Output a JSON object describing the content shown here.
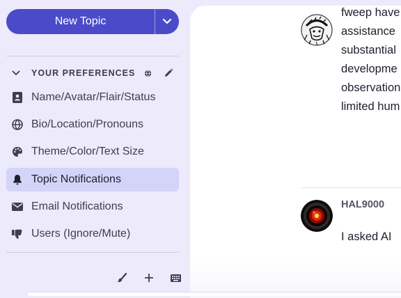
{
  "sidebar": {
    "new_topic_label": "New Topic",
    "section_title": "YOUR PREFERENCES",
    "items": [
      {
        "label": "Name/Avatar/Flair/Status",
        "icon": "id-card-icon"
      },
      {
        "label": "Bio/Location/Pronouns",
        "icon": "globe-icon"
      },
      {
        "label": "Theme/Color/Text Size",
        "icon": "palette-icon"
      },
      {
        "label": "Topic Notifications",
        "icon": "bell-icon",
        "active": true
      },
      {
        "label": "Email Notifications",
        "icon": "envelope-icon"
      },
      {
        "label": "Users (Ignore/Mute)",
        "icon": "thumbs-down-icon"
      }
    ]
  },
  "posts": [
    {
      "avatar": "luffy-sketch-avatar",
      "lines": [
        "fweep have",
        "assistance",
        "substantial",
        "developme",
        "observation",
        "limited hum"
      ]
    },
    {
      "username": "HAL9000",
      "avatar": "hal9000-red-eye-avatar",
      "lines": [
        "I asked AI"
      ]
    }
  ],
  "colors": {
    "accent": "#4b4bc9",
    "sidebar_bg": "#eceafb",
    "active_item_bg": "#d3d4f7",
    "main_bg": "#ffffff"
  }
}
